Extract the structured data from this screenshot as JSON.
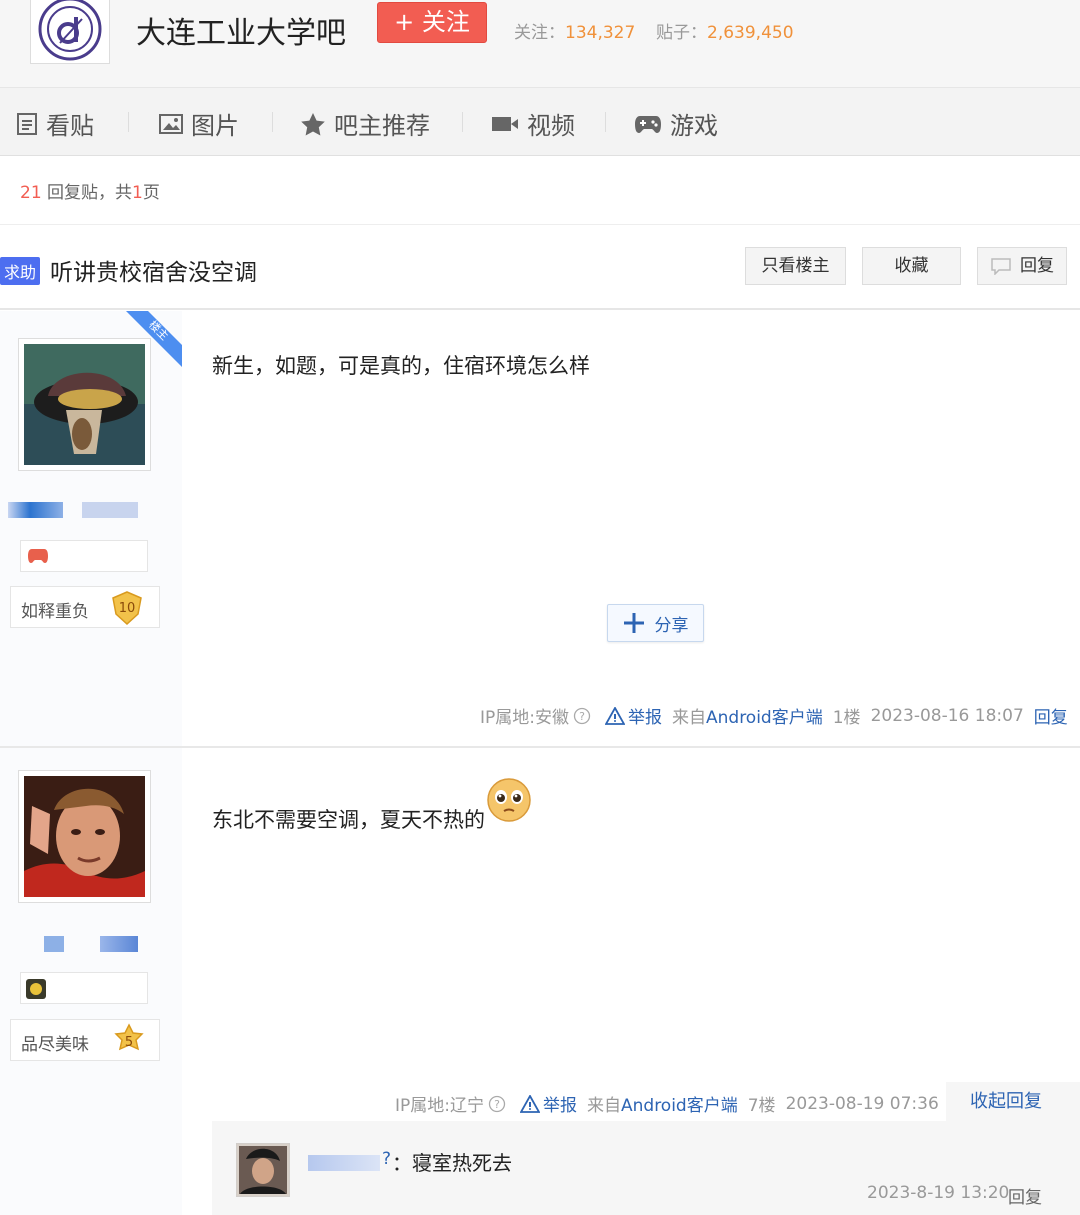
{
  "header": {
    "bar_title": "大连工业大学吧",
    "follow_label": "+ 关注",
    "followers_label": "关注：",
    "followers_value": "134,327",
    "posts_label": "贴子：",
    "posts_value": "2,639,450"
  },
  "nav": {
    "items": [
      {
        "label": "看贴",
        "icon": "document-icon"
      },
      {
        "label": "图片",
        "icon": "image-icon"
      },
      {
        "label": "吧主推荐",
        "icon": "star-icon"
      },
      {
        "label": "视频",
        "icon": "video-icon"
      },
      {
        "label": "游戏",
        "icon": "gamepad-icon"
      }
    ]
  },
  "info": {
    "reply_count": "21",
    "reply_text": " 回复贴，共",
    "page_count": "1",
    "page_text": "页"
  },
  "thread": {
    "tag": "求助",
    "title": "听讲贵校宿舍没空调",
    "btn_only_op": "只看楼主",
    "btn_collect": "收藏",
    "btn_reply": "回复"
  },
  "posts": [
    {
      "op_ribbon": "楼主",
      "text": "新生，如题，可是真的，住宿环境怎么样",
      "level_name": "如释重负",
      "level": "10",
      "share_label": "分享",
      "ip": "IP属地:安徽",
      "report": "举报",
      "source_prefix": "来自",
      "source": "Android客户端",
      "floor": "1楼",
      "time": "2023-08-16 18:07",
      "reply": "回复"
    },
    {
      "text": "东北不需要空调，夏天不热的",
      "level_name": "品尽美味",
      "level": "5",
      "ip": "IP属地:辽宁",
      "report": "举报",
      "source_prefix": "来自",
      "source": "Android客户端",
      "floor": "7楼",
      "time": "2023-08-19 07:36",
      "collapse": "收起回复",
      "sub_reply": {
        "prefix": "?",
        "text": "：寝室热死去",
        "time": "2023-8-19 13:20",
        "reply": "回复"
      }
    }
  ],
  "colors": {
    "brand_red": "#f25d52",
    "link_blue": "#2d64b3",
    "stat_orange": "#f0913a",
    "tag_blue": "#4d6ef0"
  }
}
